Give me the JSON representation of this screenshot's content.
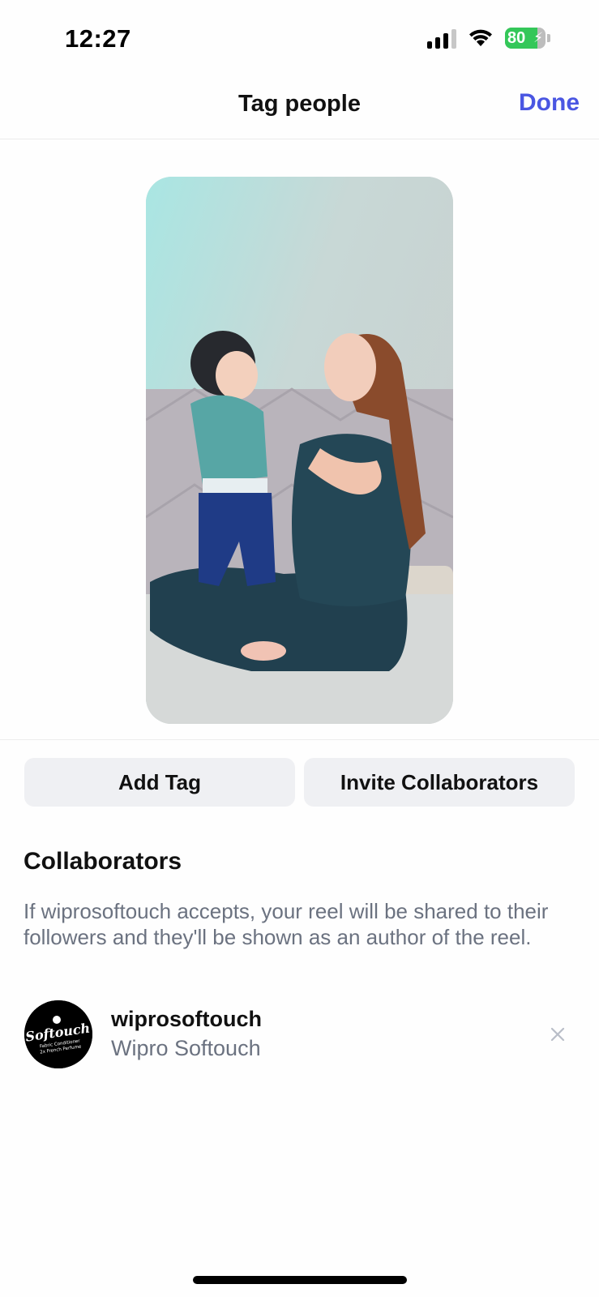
{
  "status_bar": {
    "time": "12:27",
    "battery": "80",
    "icons": [
      "signal-icon",
      "wifi-icon",
      "battery-icon"
    ]
  },
  "header": {
    "title": "Tag people",
    "done_label": "Done"
  },
  "actions": {
    "add_tag_label": "Add Tag",
    "invite_label": "Invite Collaborators"
  },
  "collaborators": {
    "title": "Collaborators",
    "description": "If wiprosoftouch accepts, your reel will be shared to their followers and they'll be shown as an author of the reel.",
    "items": [
      {
        "username": "wiprosoftouch",
        "full_name": "Wipro Softouch",
        "avatar_logo_text": "Softouch",
        "avatar_tagline": "Fabric Conditioner",
        "avatar_sub": "2x French Perfume"
      }
    ]
  },
  "colors": {
    "accent": "#4a56e2",
    "button_bg": "#eff0f3",
    "secondary_text": "#6b7280"
  }
}
